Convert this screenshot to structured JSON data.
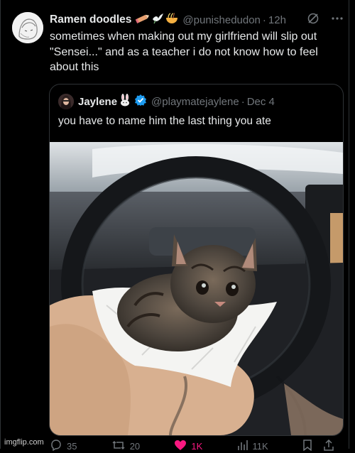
{
  "colors": {
    "background": "#000000",
    "text": "#e7e9ea",
    "muted": "#71767b",
    "verified": "#1d9bf0",
    "like": "#f91880"
  },
  "tweet": {
    "author": {
      "display_name": "Ramen doodles",
      "handle": "@punishedudon",
      "emojis": [
        "pencil-icon",
        "dove-icon",
        "ramen-icon"
      ]
    },
    "time": "12h",
    "text": "sometimes when making out my girlfriend will slip out \"Sensei...\" and as a teacher i do not know how to feel about this",
    "header_icons": [
      "grok-icon",
      "more-icon"
    ]
  },
  "quote": {
    "author": {
      "display_name": "Jaylene",
      "handle": "@playmatejaylene",
      "emojis": [
        "rabbit-icon"
      ],
      "verified": true
    },
    "date": "Dec 4",
    "text": "you have to name him the last thing you ate",
    "image": "kitten-on-napkin-photo"
  },
  "actions": {
    "replies": "35",
    "reposts": "20",
    "likes": "1K",
    "views": "11K"
  },
  "watermark": "imgflip.com"
}
